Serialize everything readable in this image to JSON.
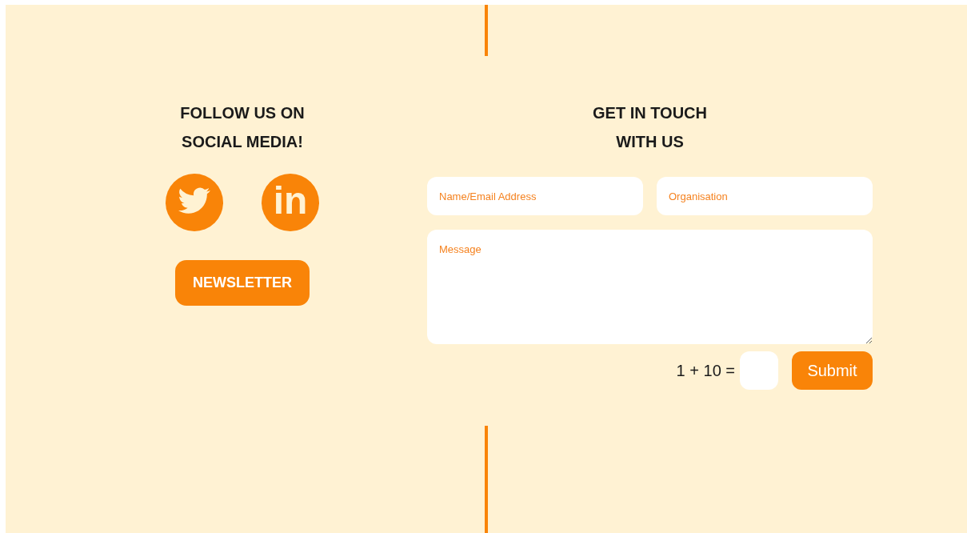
{
  "social": {
    "heading": "FOLLOW US ON SOCIAL MEDIA!",
    "icons": [
      {
        "kind": "bird"
      },
      {
        "kind": "letters",
        "label": "in"
      }
    ],
    "newsletter_button": "NEWSLETTER"
  },
  "contact": {
    "heading": "GET IN TOUCH WITH US",
    "fields": [
      {
        "placeholder": "Name/Email Address"
      },
      {
        "placeholder": "Organisation"
      }
    ],
    "message": {
      "placeholder": "Message"
    },
    "captcha": {
      "question": "1 + 10 ="
    },
    "submit_button": "Submit"
  }
}
